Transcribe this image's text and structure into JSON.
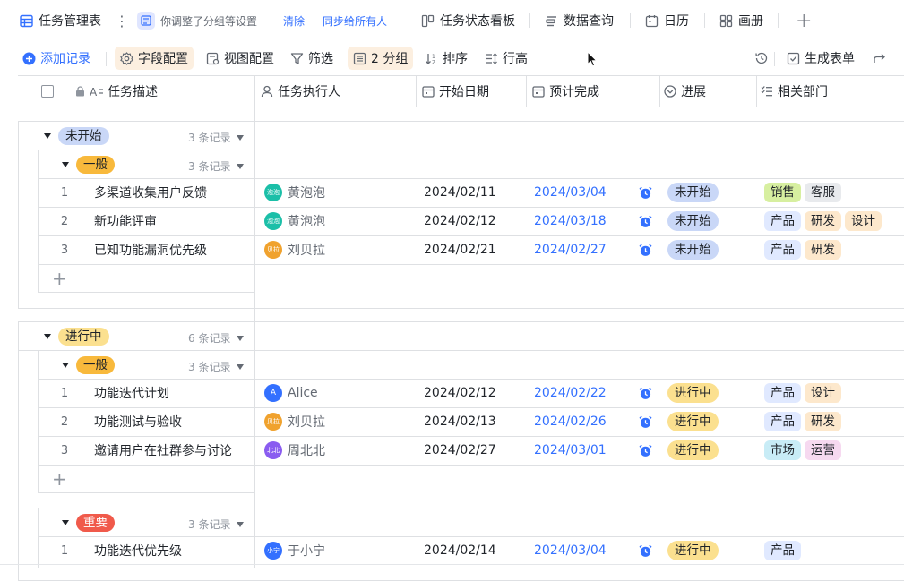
{
  "topbar": {
    "table_title": "任务管理表",
    "notice": "你调整了分组等设置",
    "clear": "清除",
    "sync": "同步给所有人",
    "views": [
      "任务状态看板",
      "数据查询",
      "日历",
      "画册"
    ],
    "add_view": "+"
  },
  "toolbar": {
    "add_record": "添加记录",
    "field_config": "字段配置",
    "view_config": "视图配置",
    "filter": "筛选",
    "group": "2 分组",
    "sort": "排序",
    "row_height": "行高",
    "generate_form": "生成表单"
  },
  "columns": [
    "任务描述",
    "任务执行人",
    "开始日期",
    "预计完成",
    "进展",
    "相关部门"
  ],
  "colors": {
    "accent": "#3370ff",
    "status_not_started": "#c9d7f7",
    "status_in_progress": "#fbe08f",
    "priority_normal": "#f8b93c",
    "priority_important": "#f05a4b"
  },
  "groups": [
    {
      "label": "未开始",
      "count": "3 条记录",
      "subgroups": [
        {
          "label": "一般",
          "count": "3 条记录",
          "rows": [
            {
              "index": "1",
              "task": "多渠道收集用户反馈",
              "avatar": "泡泡",
              "assignee": "黄泡泡",
              "start": "2024/02/11",
              "due": "2024/03/04",
              "status": "未开始",
              "tags": [
                "销售",
                "客服"
              ]
            },
            {
              "index": "2",
              "task": "新功能评审",
              "avatar": "泡泡",
              "assignee": "黄泡泡",
              "start": "2024/02/12",
              "due": "2024/03/18",
              "status": "未开始",
              "tags": [
                "产品",
                "研发",
                "设计"
              ]
            },
            {
              "index": "3",
              "task": "已知功能漏洞优先级",
              "avatar": "贝拉",
              "assignee": "刘贝拉",
              "start": "2024/02/21",
              "due": "2024/02/27",
              "status": "未开始",
              "tags": [
                "产品",
                "研发"
              ]
            }
          ]
        }
      ]
    },
    {
      "label": "进行中",
      "count": "6 条记录",
      "subgroups": [
        {
          "label": "一般",
          "count": "3 条记录",
          "rows": [
            {
              "index": "1",
              "task": "功能迭代计划",
              "avatar": "A",
              "assignee": "Alice",
              "start": "2024/02/12",
              "due": "2024/02/22",
              "status": "进行中",
              "tags": [
                "产品",
                "设计"
              ]
            },
            {
              "index": "2",
              "task": "功能测试与验收",
              "avatar": "贝拉",
              "assignee": "刘贝拉",
              "start": "2024/02/13",
              "due": "2024/02/26",
              "status": "进行中",
              "tags": [
                "产品",
                "研发"
              ]
            },
            {
              "index": "3",
              "task": "邀请用户在社群参与讨论",
              "avatar": "北北",
              "assignee": "周北北",
              "start": "2024/02/27",
              "due": "2024/03/01",
              "status": "进行中",
              "tags": [
                "市场",
                "运营"
              ]
            }
          ]
        },
        {
          "label": "重要",
          "count": "3 条记录",
          "rows": [
            {
              "index": "1",
              "task": "功能迭代优先级",
              "avatar": "小宁",
              "assignee": "于小宁",
              "start": "2024/02/14",
              "due": "2024/03/04",
              "status": "进行中",
              "tags": [
                "产品"
              ]
            }
          ]
        }
      ]
    }
  ]
}
